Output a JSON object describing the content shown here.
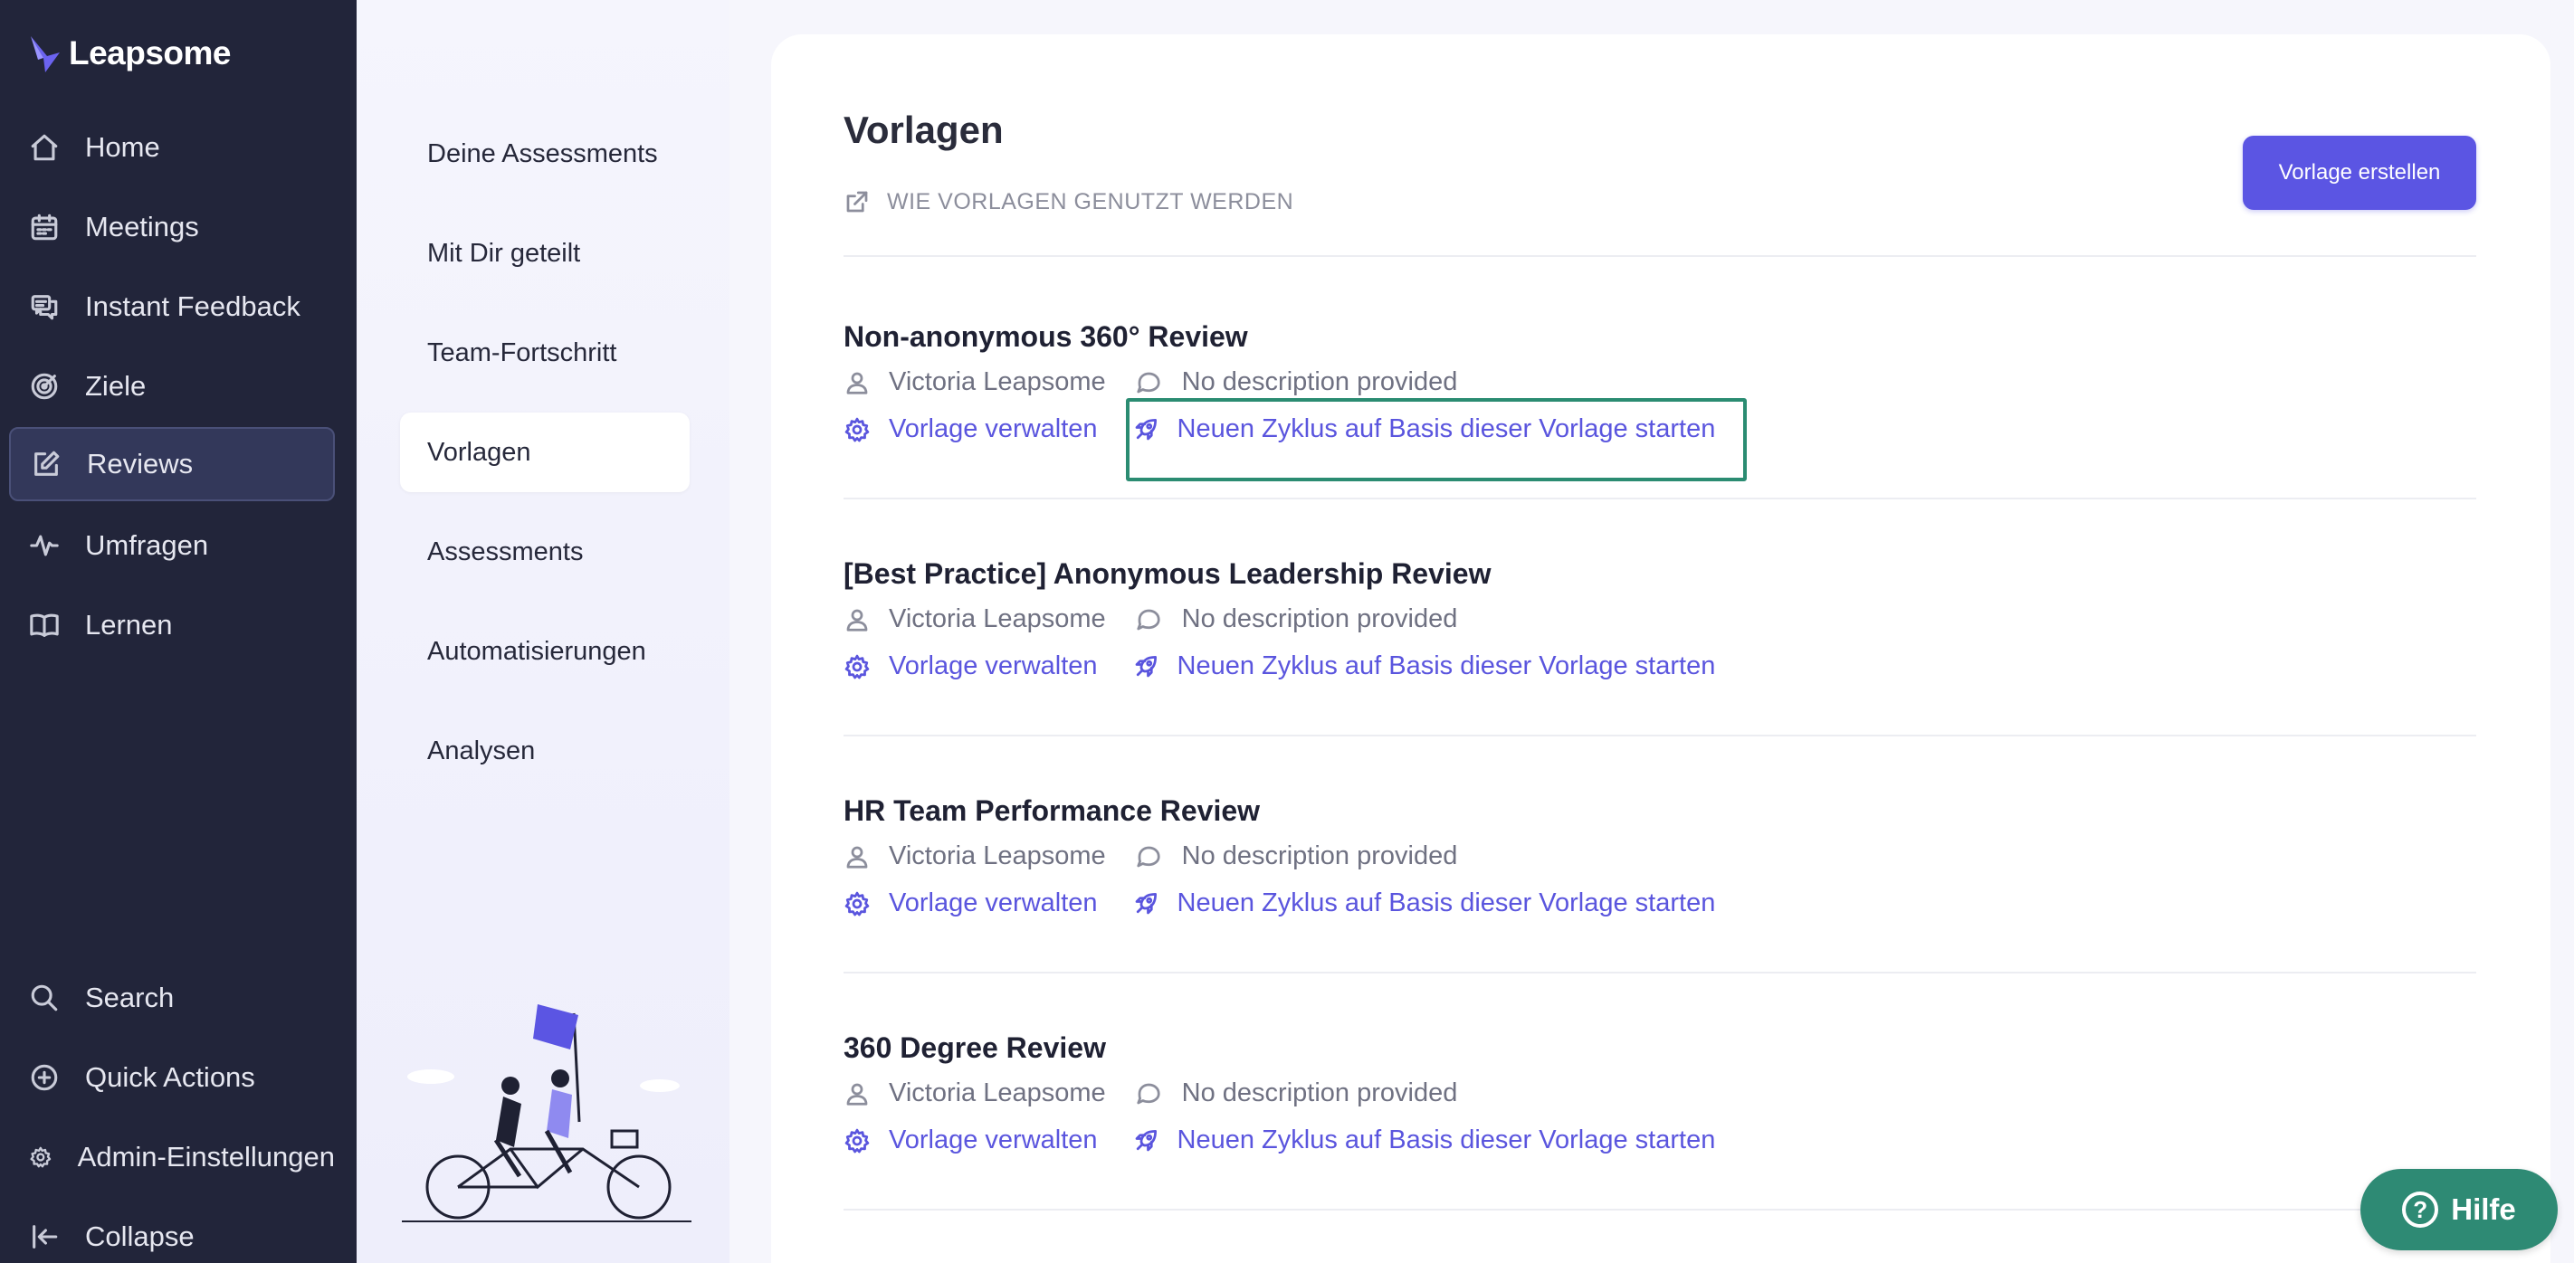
{
  "brand": {
    "name": "Leapsome",
    "accent": "#5b55e3",
    "sidebar_bg": "#22253a"
  },
  "sidebar": {
    "items": [
      {
        "label": "Home",
        "icon": "home-icon"
      },
      {
        "label": "Meetings",
        "icon": "calendar-icon"
      },
      {
        "label": "Instant Feedback",
        "icon": "chat-bubbles-icon"
      },
      {
        "label": "Ziele",
        "icon": "target-icon"
      },
      {
        "label": "Reviews",
        "icon": "edit-icon",
        "active": true
      },
      {
        "label": "Umfragen",
        "icon": "pulse-icon"
      },
      {
        "label": "Lernen",
        "icon": "book-icon"
      }
    ],
    "bottom": [
      {
        "label": "Search",
        "icon": "search-icon"
      },
      {
        "label": "Quick Actions",
        "icon": "plus-circle-icon"
      },
      {
        "label": "Admin-Einstellungen",
        "icon": "gear-icon"
      },
      {
        "label": "Collapse",
        "icon": "collapse-icon"
      }
    ]
  },
  "subnav": {
    "items": [
      {
        "label": "Deine Assessments"
      },
      {
        "label": "Mit Dir geteilt"
      },
      {
        "label": "Team-Fortschritt"
      },
      {
        "label": "Vorlagen",
        "active": true
      },
      {
        "label": "Assessments"
      },
      {
        "label": "Automatisierungen"
      },
      {
        "label": "Analysen"
      }
    ]
  },
  "main": {
    "title": "Vorlagen",
    "help_link": "WIE VORLAGEN GENUTZT WERDEN",
    "create_button": "Vorlage erstellen",
    "templates": [
      {
        "title": "Non-anonymous 360° Review",
        "author": "Victoria Leapsome",
        "description": "No description provided",
        "manage_label": "Vorlage verwalten",
        "start_label": "Neuen Zyklus auf Basis dieser Vorlage starten"
      },
      {
        "title": "[Best Practice] Anonymous Leadership Review",
        "author": "Victoria Leapsome",
        "description": "No description provided",
        "manage_label": "Vorlage verwalten",
        "start_label": "Neuen Zyklus auf Basis dieser Vorlage starten"
      },
      {
        "title": "HR Team Performance Review",
        "author": "Victoria Leapsome",
        "description": "No description provided",
        "manage_label": "Vorlage verwalten",
        "start_label": "Neuen Zyklus auf Basis dieser Vorlage starten"
      },
      {
        "title": "360 Degree Review",
        "author": "Victoria Leapsome",
        "description": "No description provided",
        "manage_label": "Vorlage verwalten",
        "start_label": "Neuen Zyklus auf Basis dieser Vorlage starten"
      }
    ]
  },
  "help_widget": {
    "label": "Hilfe",
    "color": "#2e8a74"
  }
}
